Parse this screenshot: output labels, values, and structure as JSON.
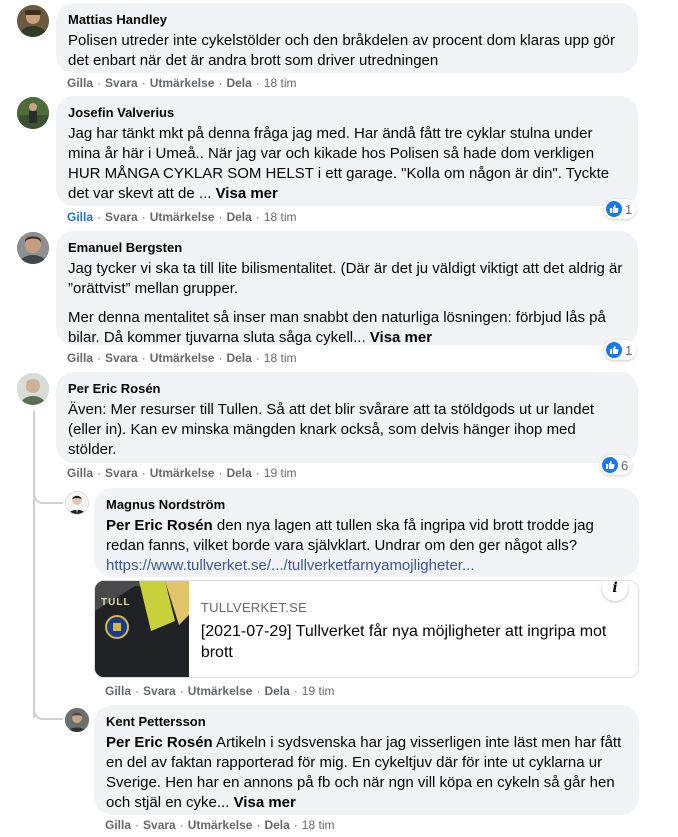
{
  "actions": {
    "like": "Gilla",
    "reply": "Svara",
    "award": "Utmärkelse",
    "share": "Dela"
  },
  "comments": [
    {
      "author": "Mattias Handley",
      "paragraphs": [
        "Polisen utreder inte cykelstölder och den bråkdelen av procent dom klaras upp gör det enbart när det är andra brott som driver utredningen"
      ],
      "time": "18 tim"
    },
    {
      "author": "Josefin Valverius",
      "paragraphs": [
        "Jag har tänkt mkt på denna fråga jag med. Har ändå fått tre cyklar stulna under mina år här i Umeå.. När jag var och kikade hos Polisen så hade dom verkligen HUR MÅNGA CYKLAR SOM HELST i ett garage. \"Kolla om någon är din\". Tyckte det var skevt att de ..."
      ],
      "see_more": "Visa mer",
      "time": "18 tim",
      "reactions": "1"
    },
    {
      "author": "Emanuel Bergsten",
      "paragraphs": [
        "Jag tycker vi ska ta till lite bilismentalitet. (Där är det ju väldigt viktigt att det aldrig är ”orättvist” mellan grupper.",
        "Mer denna mentalitet så inser man snabbt den naturliga lösningen: förbjud lås på bilar. Då kommer tjuvarna sluta såga cykell..."
      ],
      "see_more": "Visa mer",
      "time": "18 tim",
      "reactions": "1"
    },
    {
      "author": "Per Eric Rosén",
      "paragraphs": [
        "Även: Mer resurser till Tullen. Så att det blir svårare att ta stöldgods ut ur landet (eller in). Kan ev minska mängden knark också, som delvis hänger ihop med stölder."
      ],
      "time": "19 tim",
      "reactions": "6"
    }
  ],
  "replies": [
    {
      "author": "Magnus Nordström",
      "mention": "Per Eric Rosén",
      "text": " den nya lagen att tullen ska få ingripa vid brott trodde jag redan fanns, vilket borde vara självklart. Undrar om den ger något alls?",
      "link": "https://www.tullverket.se/.../tullverketfarnyamojligheter...",
      "time": "19 tim",
      "preview": {
        "domain": "TULLVERKET.SE",
        "title": "[2021-07-29] Tullverket får nya möjligheter att ingripa mot brott",
        "vest_text": "TULL",
        "info_glyph": "i"
      }
    },
    {
      "author": "Kent Pettersson",
      "mention": "Per Eric Rosén",
      "text": " Artikeln i sydsvenska har jag visserligen inte läst men har fått en del av faktan rapporterad för mig. En cykeltjuv där för inte ut cyklarna ur Sverige. Hen har en annons på fb och när ngn vill köpa en cykeln så går hen och stjäl en cyke...",
      "see_more": "Visa mer",
      "time": "18 tim"
    }
  ],
  "colors": {
    "bubble": "#f0f2f5",
    "meta": "#65676b",
    "like_blue": "#1877f2",
    "liked_text": "#216fdb",
    "link": "#385898"
  }
}
